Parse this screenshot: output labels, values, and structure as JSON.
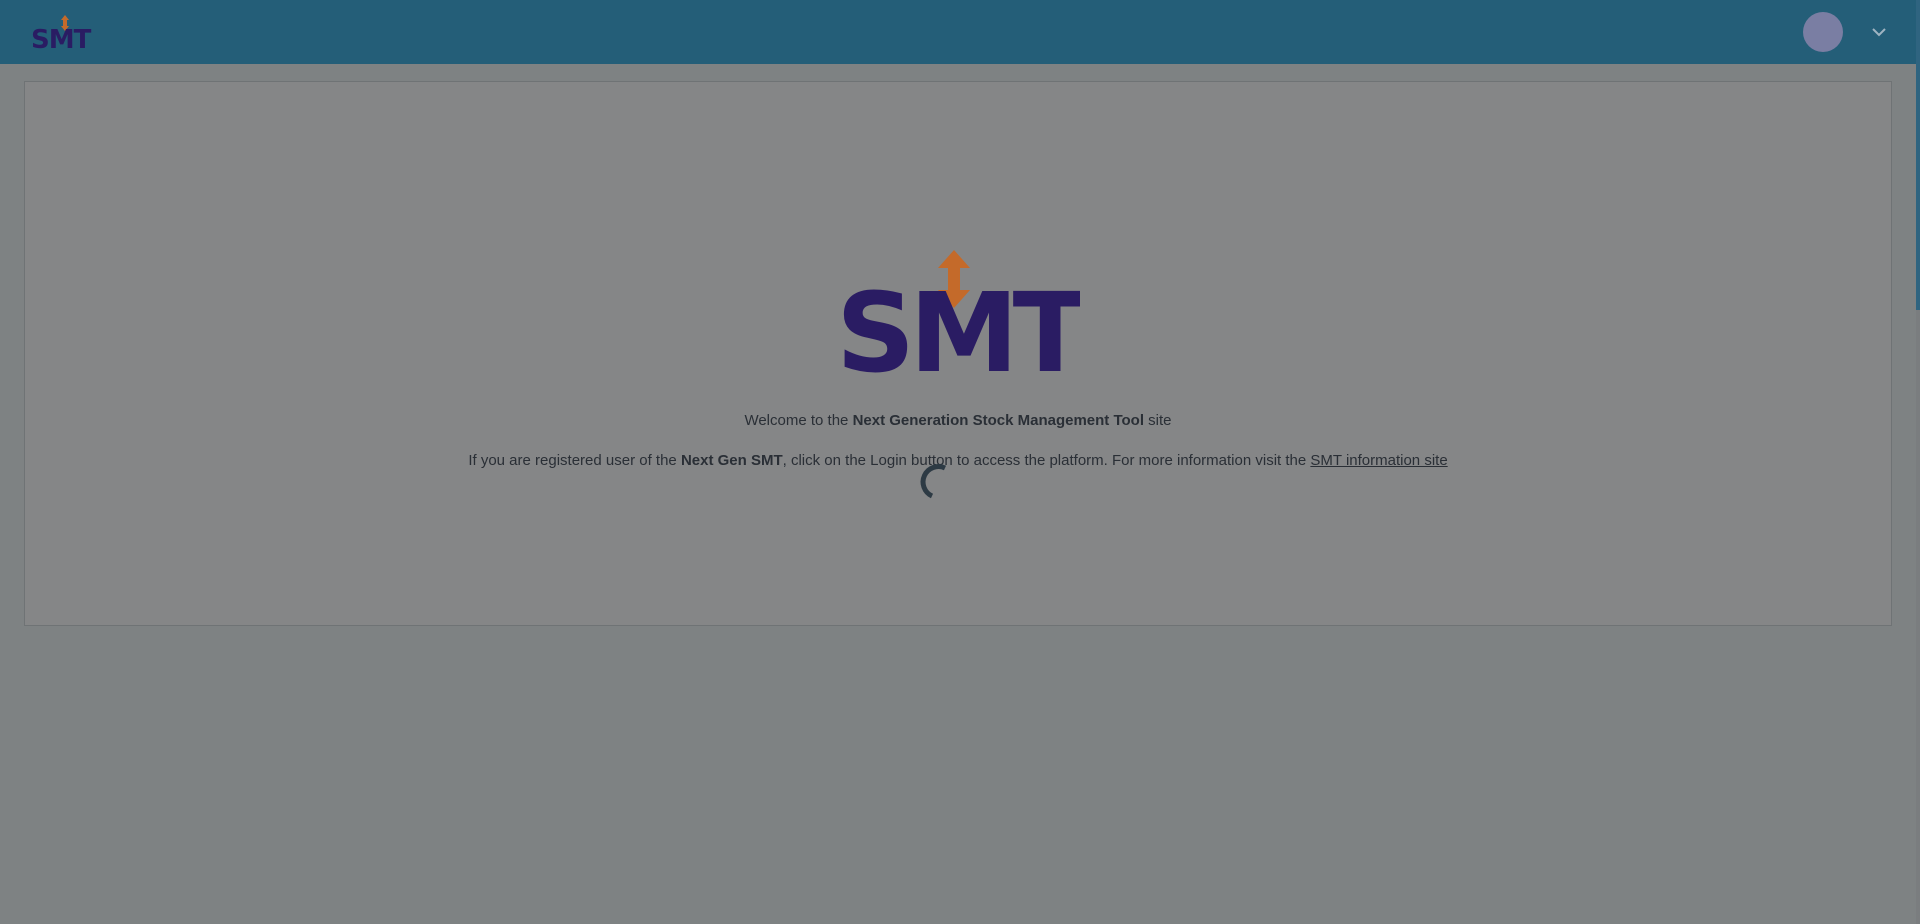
{
  "header": {
    "logo_text": "SMT",
    "avatar_icon": "user-avatar",
    "menu_icon": "chevron-down-icon"
  },
  "welcome": {
    "prefix": "Welcome to the ",
    "product_name": "Next Generation Stock Management Tool",
    "suffix": " site"
  },
  "info": {
    "prefix": "If you are registered user of the ",
    "short_name": "Next Gen SMT",
    "middle": ", click on the Login button to access the platform. For more information visit the ",
    "link_text": "SMT information site"
  },
  "logo": {
    "text": "SMT"
  },
  "colors": {
    "header_bg": "#245e78",
    "logo_purple": "#2a1c63",
    "logo_orange": "#c46a2a",
    "overlay_bg": "#7e8283"
  }
}
